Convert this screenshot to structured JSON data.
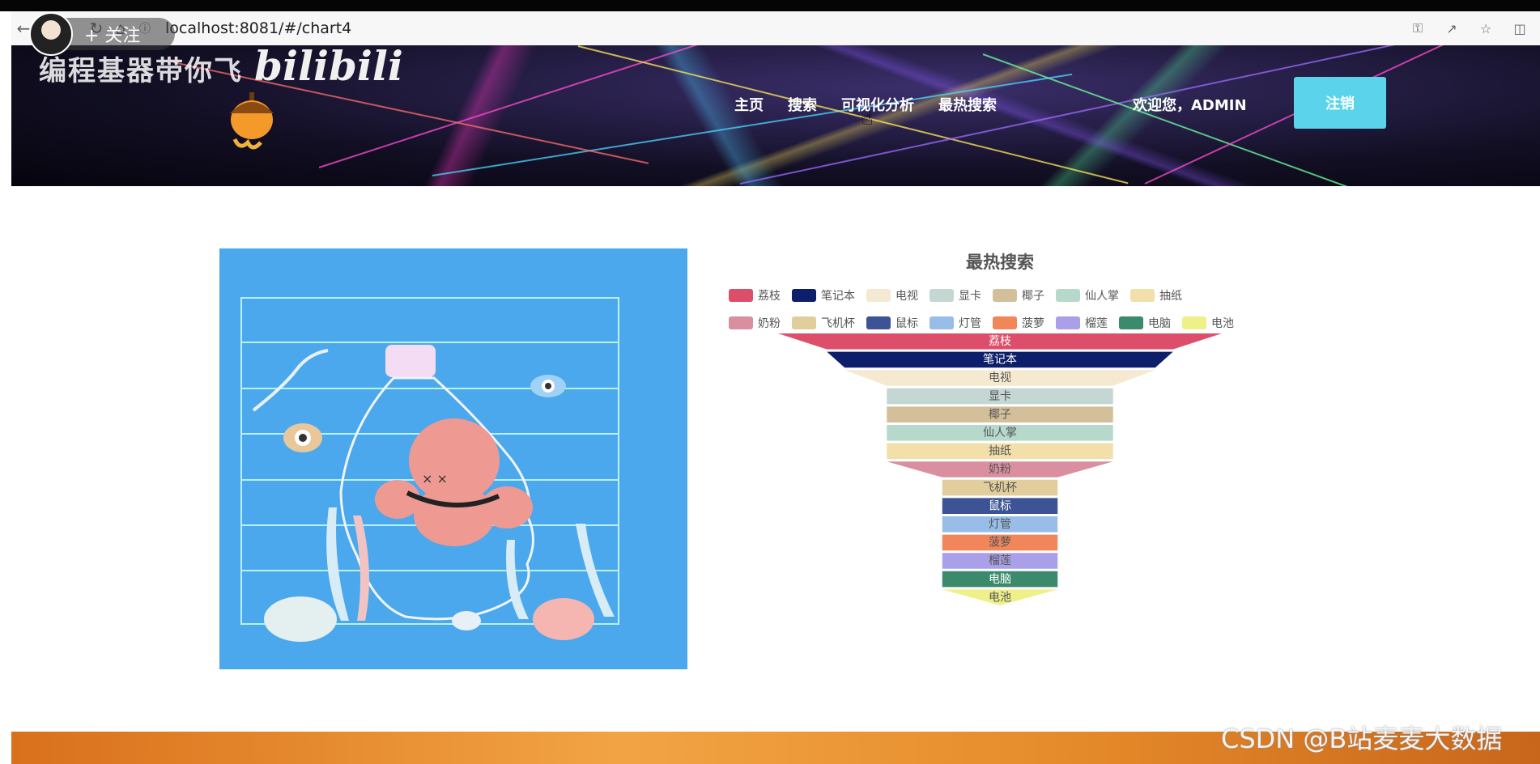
{
  "browser": {
    "url": "localhost:8081/#/chart4",
    "back_icon": "arrow-left-icon",
    "reload_icon": "reload-icon",
    "home_icon": "home-icon",
    "info_icon": "info-icon"
  },
  "overlay": {
    "follow_label": "+ 关注",
    "brand_text": "编程基器带你飞",
    "bili_logo": "bilibili"
  },
  "header": {
    "nav": [
      "主页",
      "搜索",
      "可视化分析",
      "最热搜索"
    ],
    "welcome": "欢迎您，ADMIN",
    "logout_label": "注销"
  },
  "chart_data": {
    "type": "funnel",
    "title": "最热搜索",
    "categories": [
      "荔枝",
      "笔记本",
      "电视",
      "显卡",
      "椰子",
      "仙人掌",
      "抽纸",
      "奶粉",
      "飞机杯",
      "鼠标",
      "灯管",
      "菠萝",
      "榴莲",
      "电脑",
      "电池"
    ],
    "values": [
      100,
      78,
      70,
      51,
      51,
      51,
      51,
      51,
      26,
      26,
      26,
      26,
      26,
      26,
      26
    ],
    "colors": [
      "#dd4e6a",
      "#0d1f6b",
      "#f5ead1",
      "#c4d7d3",
      "#d3bf9a",
      "#b7d9cc",
      "#f2dfa9",
      "#d98fa0",
      "#e2cd9c",
      "#3c5496",
      "#97bde8",
      "#f0865a",
      "#aaa0ea",
      "#3b8a6b",
      "#eef08a"
    ],
    "label_colors": [
      "#ffffff",
      "#ffffff",
      "#555555",
      "#555555",
      "#555555",
      "#555555",
      "#555555",
      "#555555",
      "#555555",
      "#ffffff",
      "#555555",
      "#555555",
      "#555555",
      "#ffffff",
      "#555555"
    ],
    "legend_placement": "top"
  },
  "watermark": "CSDN @B站麦麦大数据"
}
